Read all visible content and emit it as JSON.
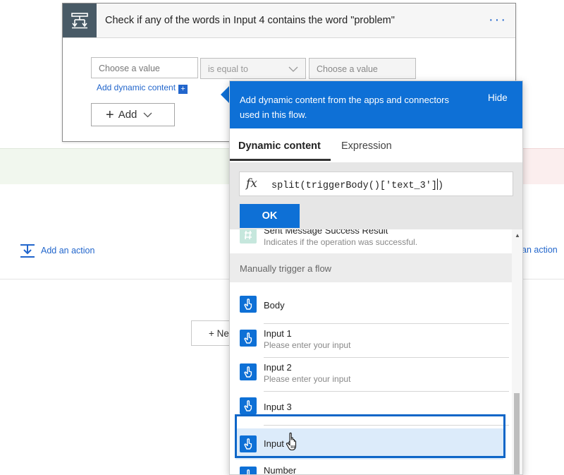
{
  "card": {
    "title": "Check if any of the words in Input 4 contains the word \"problem\"",
    "more": "···",
    "left_placeholder": "Choose a value",
    "operator": "is equal to",
    "right_placeholder": "Choose a value",
    "dynamic_link": "Add dynamic content",
    "dynamic_plus": "+",
    "add_label": "Add"
  },
  "canvas": {
    "add_action": "Add an action",
    "add_action_right": "an action",
    "new_step": "+ Ne"
  },
  "flyout": {
    "header_text": "Add dynamic content from the apps and connectors used in this flow.",
    "hide": "Hide",
    "tabs": [
      "Dynamic content",
      "Expression"
    ],
    "fx": "fx",
    "expression": "split(triggerBody()['text_3']",
    "expression_after_caret": ")",
    "ok": "OK",
    "top_item": {
      "title": "Sent Message Success Result",
      "subtitle": "Indicates if the operation was successful."
    },
    "section": "Manually trigger a flow",
    "items": [
      {
        "title": "Body",
        "subtitle": ""
      },
      {
        "title": "Input 1",
        "subtitle": "Please enter your input"
      },
      {
        "title": "Input 2",
        "subtitle": "Please enter your input"
      },
      {
        "title": "Input 3",
        "subtitle": ""
      },
      {
        "title": "Input 4",
        "subtitle": ""
      },
      {
        "title": "Number",
        "subtitle": ""
      }
    ]
  },
  "colors": {
    "accent": "#0e70d6",
    "highlight": "#0e66c8",
    "condition_icon_bg": "#485a66"
  }
}
